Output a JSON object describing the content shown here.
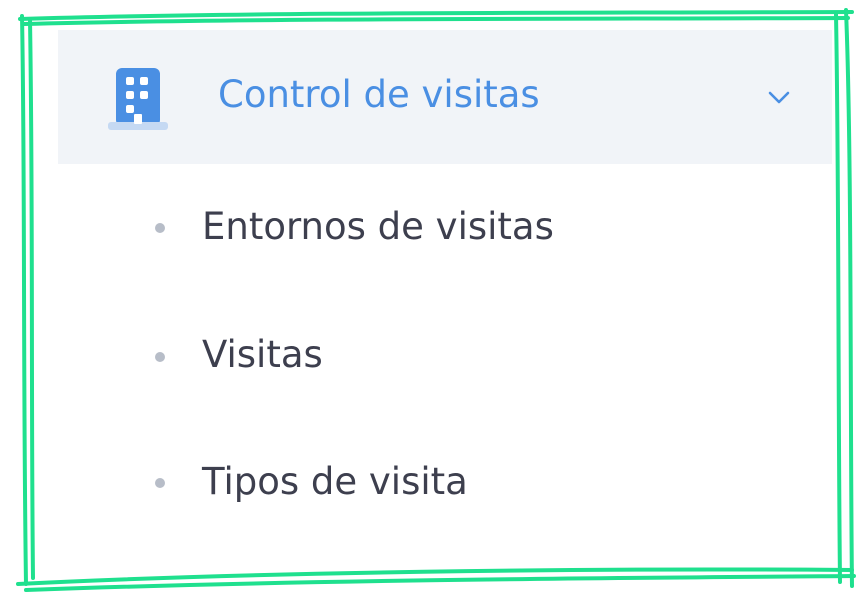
{
  "accent_color": "#1fe08e",
  "menu": {
    "title": "Control de visitas",
    "icon": "building-icon",
    "expanded": true,
    "expand_icon": "chevron-down-icon",
    "title_color": "#4a8fe3",
    "items": [
      {
        "label": "Entornos de visitas"
      },
      {
        "label": "Visitas"
      },
      {
        "label": "Tipos de visita"
      }
    ]
  }
}
